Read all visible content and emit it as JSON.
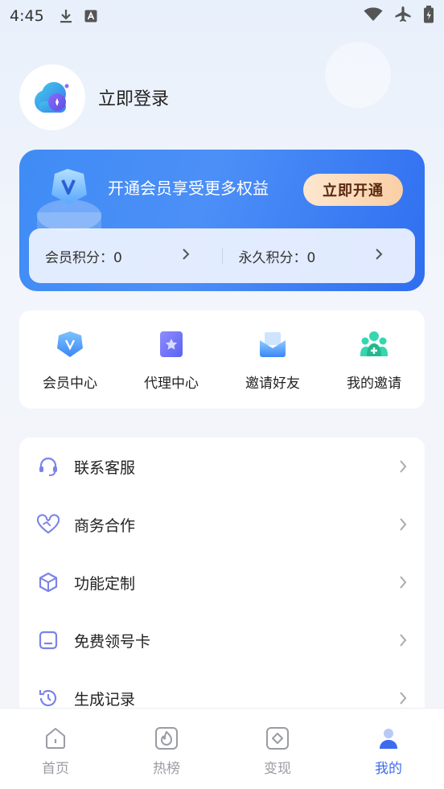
{
  "status_bar": {
    "time": "4:45"
  },
  "profile": {
    "login_label": "立即登录"
  },
  "vip": {
    "title": "开通会员享受更多权益",
    "button_label": "立即开通",
    "member_points_label": "会员积分：0",
    "permanent_points_label": "永久积分：0"
  },
  "quick_actions": [
    {
      "label": "会员中心",
      "icon": "vip-shield-icon"
    },
    {
      "label": "代理中心",
      "icon": "agent-star-icon"
    },
    {
      "label": "邀请好友",
      "icon": "invite-envelope-icon"
    },
    {
      "label": "我的邀请",
      "icon": "people-group-icon"
    }
  ],
  "menu": [
    {
      "label": "联系客服",
      "icon": "headset-icon"
    },
    {
      "label": "商务合作",
      "icon": "handshake-heart-icon"
    },
    {
      "label": "功能定制",
      "icon": "cube-icon"
    },
    {
      "label": "免费领号卡",
      "icon": "sim-card-icon"
    },
    {
      "label": "生成记录",
      "icon": "history-icon"
    }
  ],
  "tabs": [
    {
      "label": "首页",
      "icon": "home-icon",
      "active": false
    },
    {
      "label": "热榜",
      "icon": "flame-icon",
      "active": false
    },
    {
      "label": "变现",
      "icon": "diamond-icon",
      "active": false
    },
    {
      "label": "我的",
      "icon": "user-icon",
      "active": true
    }
  ],
  "colors": {
    "accent": "#3d6bf0",
    "vip_gradient_start": "#3f8cf5",
    "vip_button": "#f9cfa6",
    "icon_purple": "#7b83e6"
  }
}
